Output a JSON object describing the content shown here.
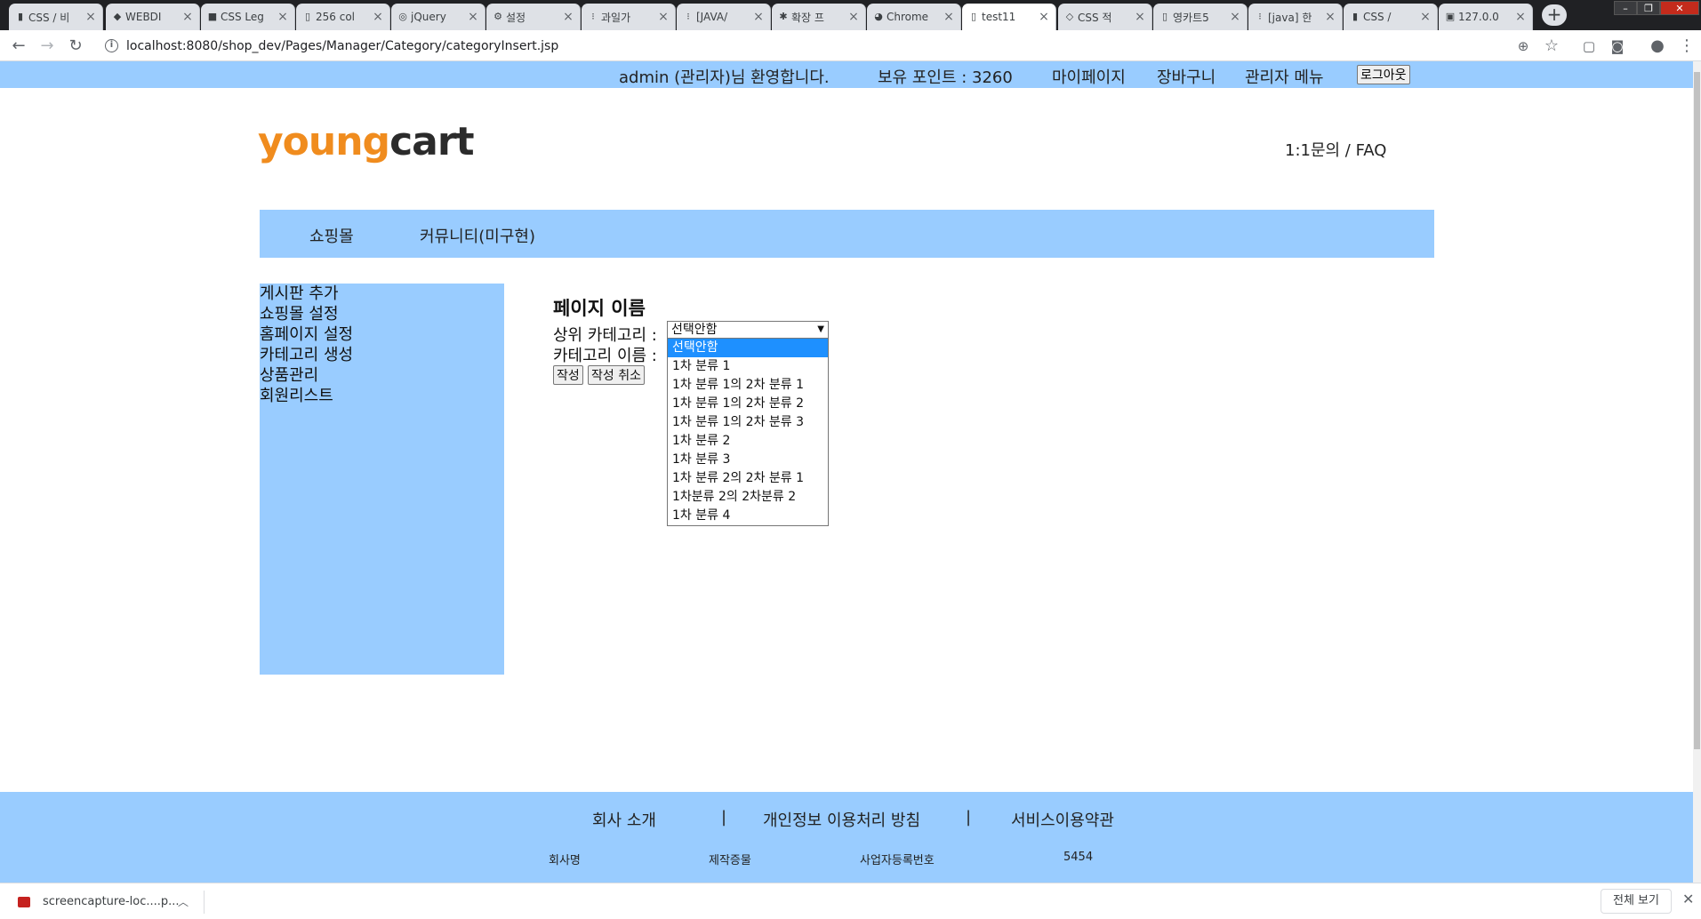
{
  "browser": {
    "tabs": [
      {
        "title": "CSS / 비",
        "icon": "chart-icon"
      },
      {
        "title": "WEBDI",
        "icon": "web-icon"
      },
      {
        "title": "CSS Leg",
        "icon": "w3-icon"
      },
      {
        "title": "256 col",
        "icon": "page-icon"
      },
      {
        "title": "jQuery",
        "icon": "jquery-icon"
      },
      {
        "title": "설정",
        "icon": "gear-icon"
      },
      {
        "title": "과일가",
        "icon": "tistory-icon"
      },
      {
        "title": "[JAVA/",
        "icon": "tistory-icon"
      },
      {
        "title": "확장 프",
        "icon": "puzzle-icon"
      },
      {
        "title": "Chrome",
        "icon": "chrome-icon"
      },
      {
        "title": "test11",
        "icon": "page-icon"
      },
      {
        "title": "CSS 적",
        "icon": "code-icon"
      },
      {
        "title": "영카트5",
        "icon": "page-icon"
      },
      {
        "title": "[java] 한",
        "icon": "tistory-icon"
      },
      {
        "title": "CSS / ",
        "icon": "chart-icon"
      },
      {
        "title": "127.0.0",
        "icon": "image-icon"
      }
    ],
    "url": "localhost:8080/shop_dev/Pages/Manager/Category/categoryInsert.jsp"
  },
  "topbar": {
    "welcome": "admin (관리자)님 환영합니다.",
    "points": "보유 포인트 : 3260",
    "mypage": "마이페이지",
    "cart": "장바구니",
    "admin_menu": "관리자 메뉴",
    "logout": "로그아웃"
  },
  "header": {
    "logo_part1": "young",
    "logo_part2": "cart",
    "faq": "1:1문의 / FAQ"
  },
  "nav": {
    "shop": "쇼핑몰",
    "community": "커뮤니티(미구현)"
  },
  "sidebar": {
    "items": [
      "게시판 추가",
      "쇼핑몰 설정",
      "홈페이지 설정",
      "카테고리 생성",
      "상품관리",
      "회원리스트"
    ]
  },
  "form": {
    "page_title": "페이지 이름",
    "parent_label": "상위 카테고리 :",
    "name_label": "카테고리 이름 :",
    "selected": "선택안함",
    "options": [
      "선택안함",
      "1차 분류 1",
      "1차 분류 1의 2차 분류 1",
      "1차 분류 1의 2차 분류 2",
      "1차 분류 1의 2차 분류 3",
      "1차 분류 2",
      "1차 분류 3",
      "1차 분류 2의 2차 분류 1",
      "1차분류 2의 2차분류 2",
      "1차 분류 4"
    ],
    "submit": "작성",
    "cancel": "작성 취소"
  },
  "footer": {
    "about": "회사 소개",
    "sep": "|",
    "privacy": "개인정보 이용처리 방침",
    "terms": "서비스이용약관",
    "company_name": "회사명",
    "producer": "제작증물",
    "biz_no_label": "사업자등록번호",
    "biz_no": "5454"
  },
  "downloads": {
    "file": "screencapture-loc....p...",
    "show_all": "전체 보기"
  }
}
